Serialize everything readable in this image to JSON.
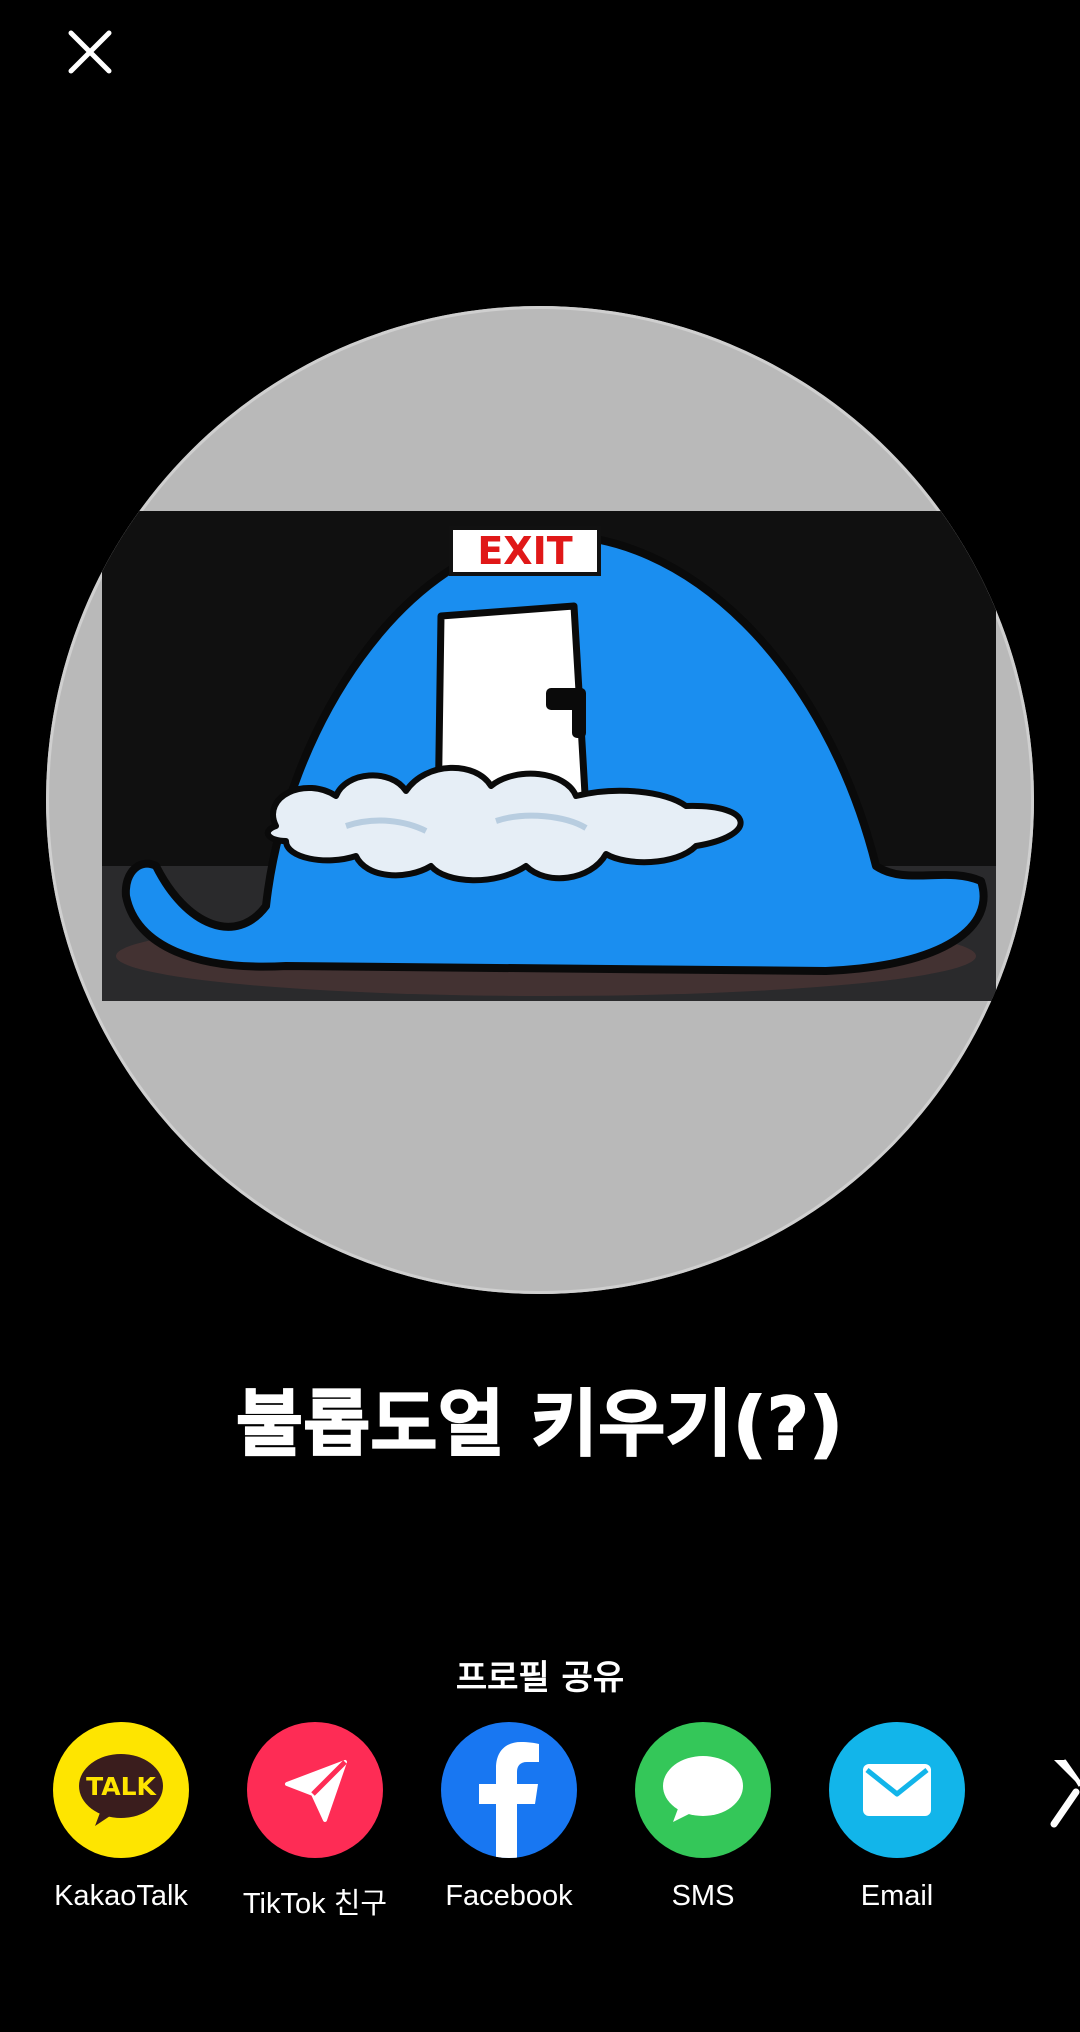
{
  "header": {
    "close_icon": "close-icon"
  },
  "profile": {
    "avatar_sign_text": "EXIT",
    "name": "불롭도얼 키우기(?)"
  },
  "share": {
    "label": "프로필 공유",
    "items": [
      {
        "label": "KakaoTalk",
        "icon": "kakaotalk-icon",
        "badge": "TALK",
        "color": "#FEE500"
      },
      {
        "label": "TikTok 친구",
        "icon": "tiktok-send-icon",
        "color": "#FE2C55"
      },
      {
        "label": "Facebook",
        "icon": "facebook-icon",
        "color": "#1877F2"
      },
      {
        "label": "SMS",
        "icon": "sms-icon",
        "color": "#34C759"
      },
      {
        "label": "Email",
        "icon": "email-icon",
        "color": "#12B5EA"
      }
    ],
    "more_icon": "x-twitter-icon"
  },
  "colors": {
    "background": "#000000",
    "avatar_bg": "#b9b9b9",
    "blob_blue": "#1a8ef0"
  }
}
